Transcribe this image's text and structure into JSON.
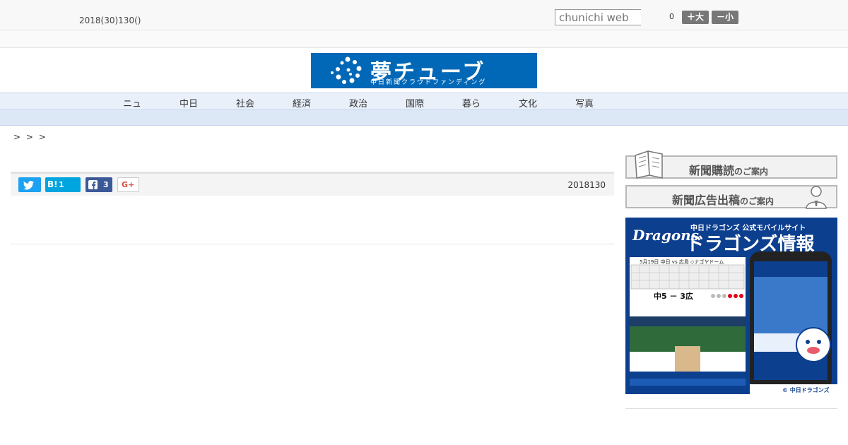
{
  "header": {
    "date": "2018(30)130()",
    "search_placeholder": "chunichi web",
    "font_size_count": "0",
    "font_up_label": "＋大",
    "font_down_label": "－小"
  },
  "banner": {
    "logo_main": "夢チューブ",
    "logo_sub": "中日新聞クラウドファンディング"
  },
  "nav": {
    "items": [
      {
        "label": "ニュ"
      },
      {
        "label": "中日"
      },
      {
        "label": "社会"
      },
      {
        "label": "経済"
      },
      {
        "label": "政治"
      },
      {
        "label": "国際"
      },
      {
        "label": "暮ら"
      },
      {
        "label": "文化"
      },
      {
        "label": "写真"
      }
    ]
  },
  "breadcrumb": "> > >",
  "share": {
    "hatena_label": "B!",
    "hatena_count": "1",
    "facebook_count": "3",
    "google_label": "G+",
    "pub_date": "2018130"
  },
  "sidebar": {
    "subscribe_main": "新聞購読",
    "subscribe_tail": "のご案内",
    "ad_main": "新聞広告出稿",
    "ad_tail": "のご案内",
    "dragons_logo": "Dragons",
    "dragons_caption": "中日ドラゴンズ 公式モバイルサイト",
    "dragons_title": "ドラゴンズ情報",
    "game_info": "5月19日 中日 vs 広島 ◇ナゴヤドーム",
    "score": "中5 － 3広",
    "copyright": "© 中日ドラゴンズ"
  },
  "colors": {
    "banner_blue": "#0068b7",
    "nav_bg": "#e9f0fa",
    "twitter": "#1da1f2",
    "hatena": "#00a4de",
    "facebook": "#3b5998",
    "dragons_navy": "#0d3f8f"
  }
}
